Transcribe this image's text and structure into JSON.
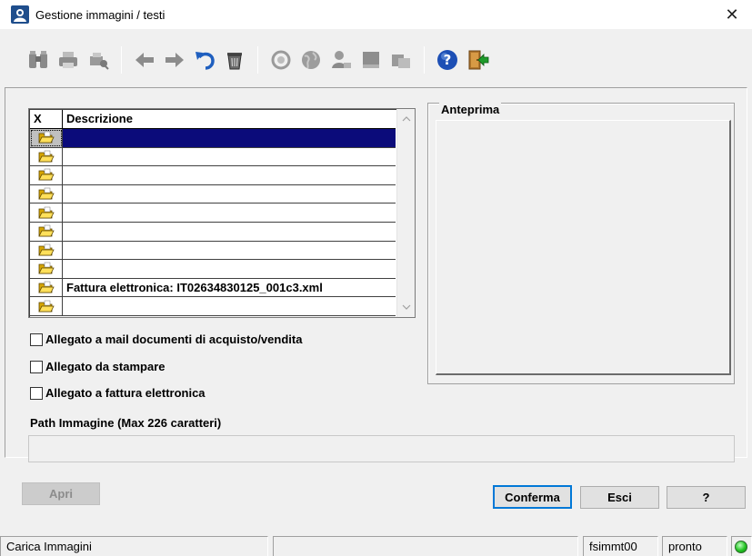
{
  "window": {
    "title": "Gestione immagini / testi",
    "close_glyph": "✕",
    "app_icon": "app-logo-icon"
  },
  "toolbar": {
    "groups": [
      [
        "binoculars-icon",
        "printer-icon",
        "print-preview-icon"
      ],
      [
        "arrow-left-icon",
        "arrow-right-icon",
        "undo-icon",
        "trash-icon"
      ],
      [
        "zoom-in-icon",
        "globe-icon",
        "user-search-icon",
        "book-icon",
        "folders-icon"
      ],
      [
        "help-icon",
        "exit-door-icon"
      ]
    ]
  },
  "grid": {
    "columns": [
      "X",
      "Descrizione"
    ],
    "rows": [
      {
        "selected": true,
        "description": ""
      },
      {
        "selected": false,
        "description": ""
      },
      {
        "selected": false,
        "description": ""
      },
      {
        "selected": false,
        "description": ""
      },
      {
        "selected": false,
        "description": ""
      },
      {
        "selected": false,
        "description": ""
      },
      {
        "selected": false,
        "description": ""
      },
      {
        "selected": false,
        "description": ""
      },
      {
        "selected": false,
        "description": "Fattura elettronica: IT02634830125_001c3.xml"
      },
      {
        "selected": false,
        "description": ""
      }
    ]
  },
  "options": {
    "mail": {
      "label": "Allegato a mail documenti di acquisto/vendita",
      "checked": false
    },
    "print": {
      "label": "Allegato da stampare",
      "checked": false
    },
    "einvoice": {
      "label": "Allegato a fattura elettronica",
      "checked": false
    }
  },
  "preview": {
    "title": "Anteprima"
  },
  "path": {
    "label": "Path Immagine (Max 226 caratteri)",
    "value": ""
  },
  "buttons": {
    "open": "Apri",
    "confirm": "Conferma",
    "exit": "Esci",
    "help": "?"
  },
  "status": {
    "message": "Carica Immagini",
    "extra": "",
    "program": "fsimmt00",
    "state": "pronto",
    "led_color": "#22c322"
  },
  "colors": {
    "selection": "#0b0b7a",
    "focus_border": "#0078d7"
  }
}
